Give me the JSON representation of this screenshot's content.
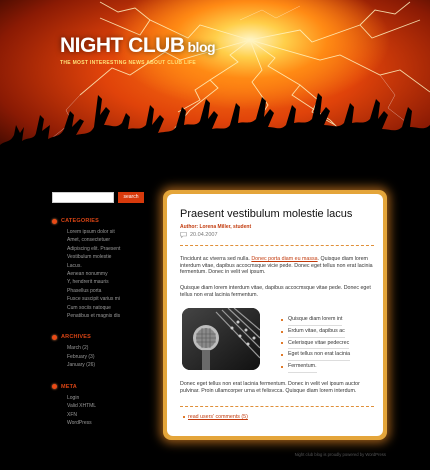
{
  "header": {
    "title": "NIGHT CLUB",
    "title_suffix": "blog",
    "tagline": "THE MOST INTERESTING NEWS ABOUT CLUB LIFE"
  },
  "search": {
    "placeholder": "",
    "button_label": "search"
  },
  "sidebar": {
    "categories": {
      "title": "CATEGORIES",
      "items": [
        "Lorem ipsum dolor sit",
        "Amet, consectetuer",
        "Adipiscing elit. Praesent",
        "Vestibulum molestie",
        "Lacus.",
        "Aenean nonummy",
        "Y, hendrerit mauris",
        "Phasellus porta",
        "Fusce suscipit varius mi",
        "Cum sociis natoque",
        "Penatibus et magnis dis"
      ]
    },
    "archives": {
      "title": "ARCHIVES",
      "items": [
        "March (2)",
        "February (3)",
        "January (26)"
      ]
    },
    "meta": {
      "title": "META",
      "items": [
        "Login",
        "Valid XHTML",
        "XFN",
        "WordPress"
      ]
    }
  },
  "post": {
    "title": "Praesent vestibulum molestie lacus",
    "author": "Author: Lorena Miller, student",
    "date": "20.04.2007",
    "para1_before": "Tincidunt ac viverra sed nulla. ",
    "para1_link": "Donec porta diam eu massa",
    "para1_after": ". Quisque diam lorem interdum vitae, dapibus accocmsque vicie pede. Donec eget tellus non erat lacinia fermentum. Donec in velit vel ipsum.",
    "para2": "Quisque diam lorem interdum vitae, dapibus accocmsque vitae pede. Donec eget tellus non erat lacinia fermentum.",
    "bullets": [
      "Quisque diam lorem int",
      "Erdum vitae, dapibus ac",
      "Celerisque vitae pedecrec",
      "Eget tellus non erat lacinia",
      "Fermentum."
    ],
    "para3": "Donec eget tellus non erat lacinia fermentum. Donec in velit vel ipsum auctor pulvinar. Proin ullamcorper urna et felisvcca. Quisque diam lorem interdum.",
    "comments_link": "read users' comments (5)"
  },
  "footer": {
    "text": "Night club blog is proudly powered by WordPress"
  },
  "colors": {
    "accent": "#e94a16",
    "frame": "#e4a53a",
    "background": "#000000"
  }
}
